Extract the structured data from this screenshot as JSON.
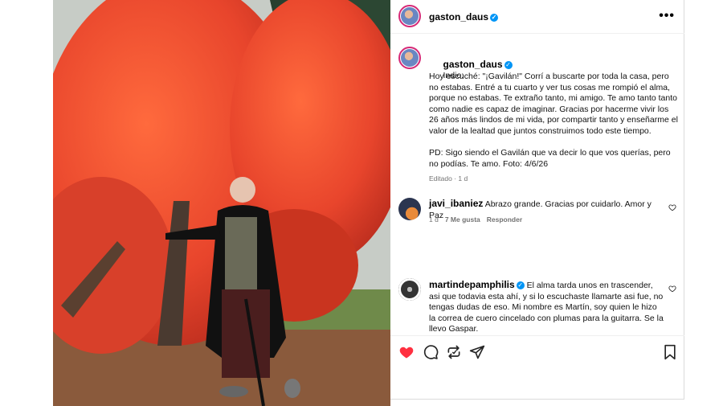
{
  "post": {
    "author": "gaston_daus",
    "verified": true,
    "photo_alt": "Hombre mayor con bastón junto a un árbol de hojas rojas en otoño",
    "caption_lead": "Indio:",
    "caption_body": "Hoy escuché: \"¡Gavilán!\" Corrí a buscarte por toda la casa, pero no estabas. Entré a tu cuarto y ver tus cosas me rompió el alma, porque no estabas. Te extraño tanto, mi amigo. Te amo tanto tanto como nadie es capaz de imaginar. Gracias por hacerme vivir los 26 años más lindos de mi vida, por compartir tanto y enseñarme el valor de la lealtad que juntos construimos todo este tiempo.\n\nPD: Sigo siendo el Gavilán que va decir lo que vos querías, pero no podías. Te amo. Foto: 4/6/26",
    "caption_meta": "Editado · 1 d"
  },
  "comments": [
    {
      "user": "javi_ibaniez",
      "verified": false,
      "text": "Abrazo grande. Gracias por cuidarlo. Amor y Paz",
      "time": "1 d",
      "likes": "7 Me gusta",
      "reply": "Responder"
    },
    {
      "user": "martindepamphilis",
      "verified": true,
      "text": "El alma tarda unos en trascender, asi que todavia esta ahí, y si lo escuchaste llamarte asi fue, no tengas dudas de eso. Mi nombre es Martín, soy quien le hizo la correa de cuero cincelado con plumas para la guitarra. Se la llevo Gaspar."
    }
  ],
  "icons": {
    "more": "more-options-icon",
    "like": "heart-icon",
    "comment": "comment-icon",
    "share": "repost-icon",
    "send": "send-icon",
    "save": "bookmark-icon"
  },
  "labels": {
    "more": "•••"
  },
  "colors": {
    "liked": "#ff3040",
    "verified": "#0095f6",
    "muted": "#737373"
  }
}
